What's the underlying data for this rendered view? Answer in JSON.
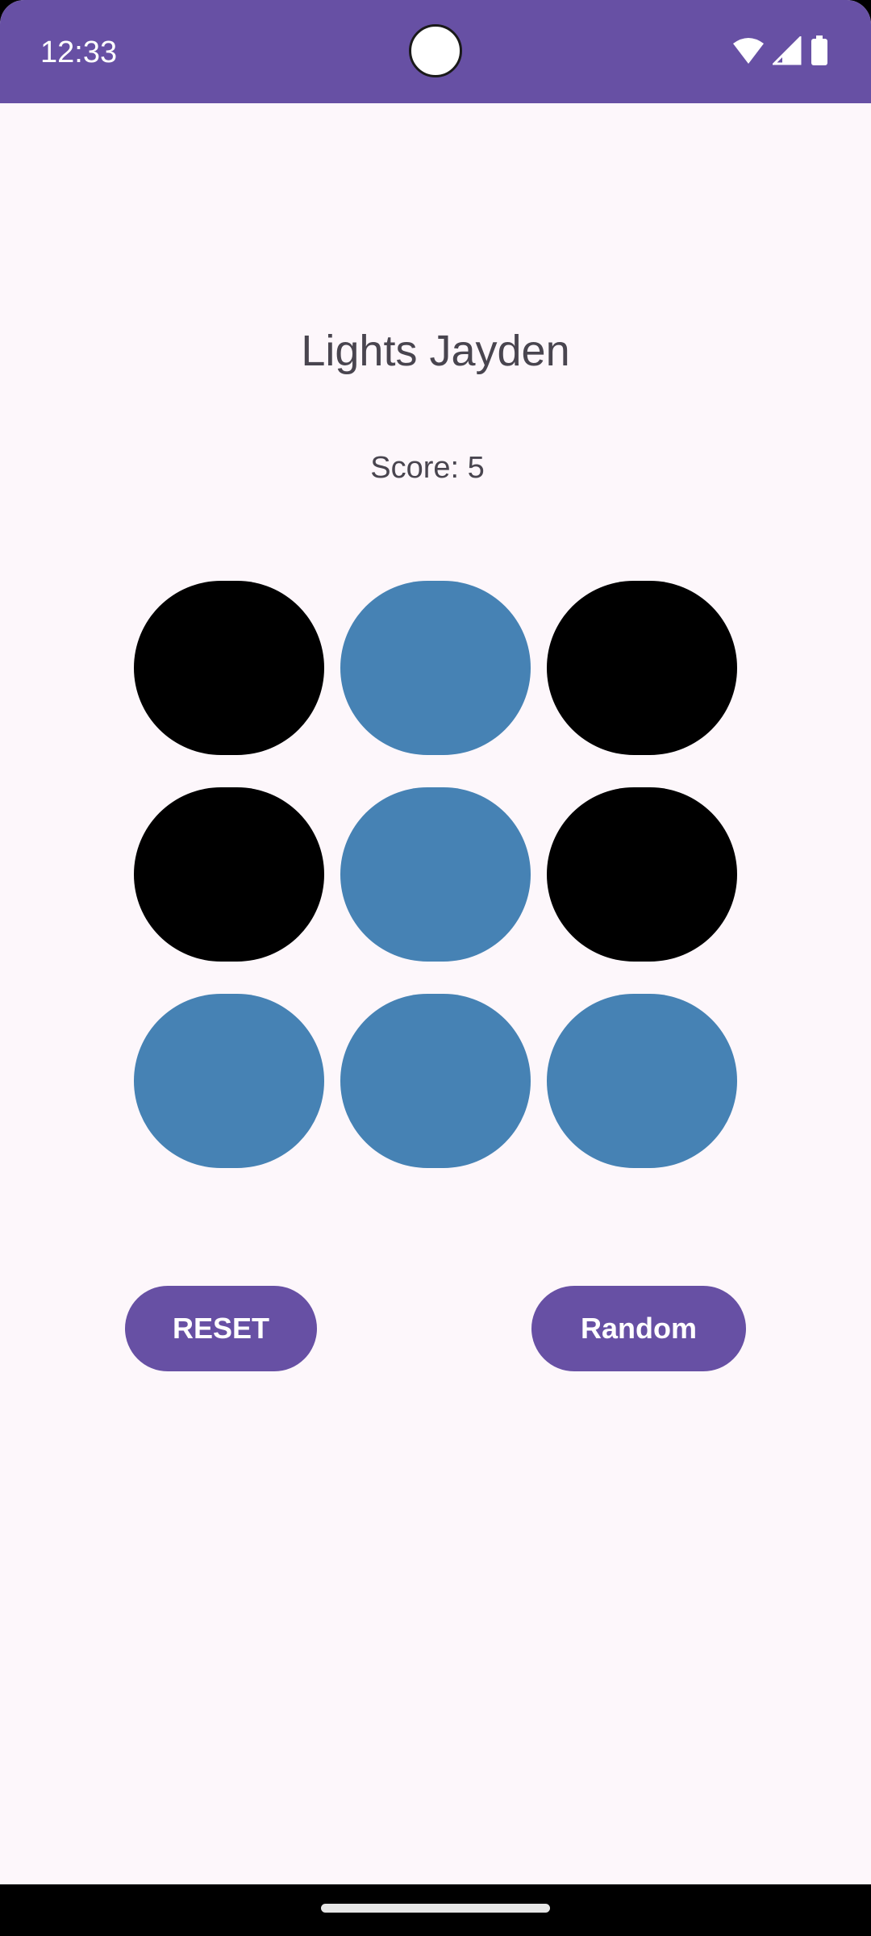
{
  "status_bar": {
    "time": "12:33",
    "icons": [
      "wifi-icon",
      "signal-icon",
      "battery-icon"
    ],
    "color": "#6750a4"
  },
  "app": {
    "title": "Lights Jayden",
    "score_text": "Score: 5"
  },
  "board": {
    "rows": 3,
    "cols": 3,
    "on_color": "#4682b4",
    "off_color": "#000000",
    "lights": [
      [
        false,
        true,
        false
      ],
      [
        false,
        true,
        false
      ],
      [
        true,
        true,
        true
      ]
    ]
  },
  "buttons": {
    "reset_label": "RESET",
    "random_label": "Random",
    "color": "#6750a4"
  }
}
